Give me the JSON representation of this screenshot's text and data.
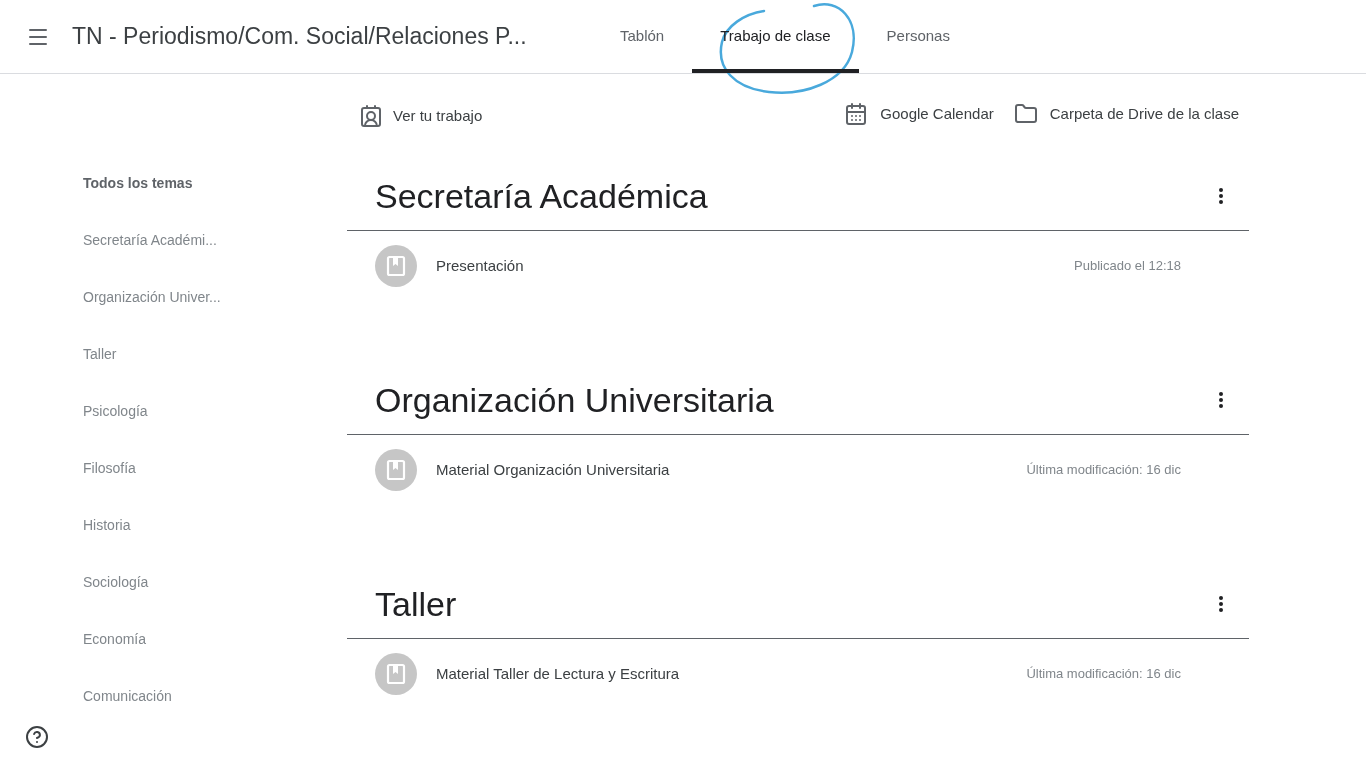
{
  "header": {
    "title": "TN - Periodismo/Com. Social/Relaciones P...",
    "tabs": [
      {
        "label": "Tablón",
        "selected": false
      },
      {
        "label": "Trabajo de clase",
        "selected": true
      },
      {
        "label": "Personas",
        "selected": false
      }
    ]
  },
  "actions": {
    "view_work": "Ver tu trabajo",
    "calendar": "Google Calendar",
    "drive": "Carpeta de Drive de la clase"
  },
  "topics": [
    {
      "label": "Todos los temas",
      "selected": true
    },
    {
      "label": "Secretaría Académi...",
      "selected": false
    },
    {
      "label": "Organización Univer...",
      "selected": false
    },
    {
      "label": "Taller",
      "selected": false
    },
    {
      "label": "Psicología",
      "selected": false
    },
    {
      "label": "Filosofía",
      "selected": false
    },
    {
      "label": "Historia",
      "selected": false
    },
    {
      "label": "Sociología",
      "selected": false
    },
    {
      "label": "Economía",
      "selected": false
    },
    {
      "label": "Comunicación",
      "selected": false
    }
  ],
  "sections": [
    {
      "title": "Secretaría Académica",
      "items": [
        {
          "title": "Presentación",
          "meta": "Publicado el 12:18"
        }
      ]
    },
    {
      "title": "Organización Universitaria",
      "items": [
        {
          "title": "Material Organización Universitaria",
          "meta": "Última modificación: 16 dic"
        }
      ]
    },
    {
      "title": "Taller",
      "items": [
        {
          "title": "Material Taller de Lectura y Escritura",
          "meta": "Última modificación: 16 dic"
        }
      ]
    }
  ]
}
